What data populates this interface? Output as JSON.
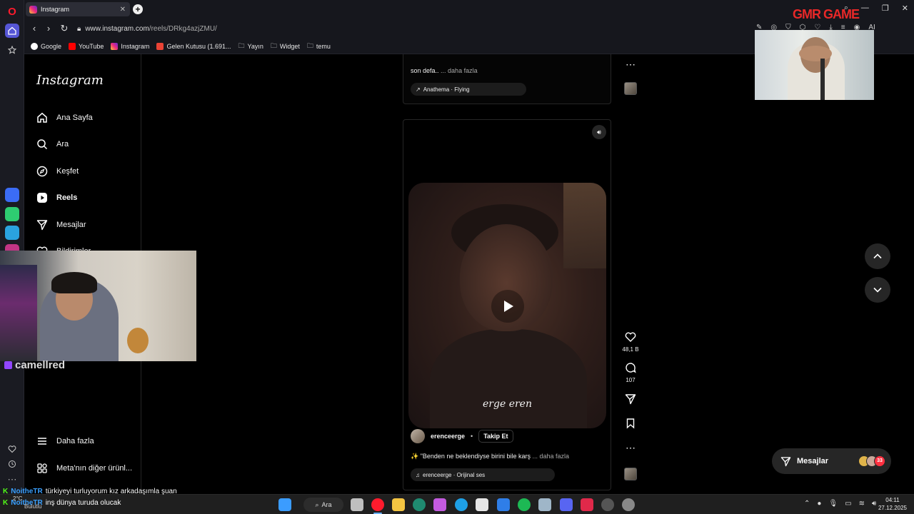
{
  "browser": {
    "tab_title": "Instagram",
    "url_host": "www.instagram.com",
    "url_path": "/reels/DRkg4azjZMU/",
    "brand_overlay": "GMR GAME",
    "bookmarks": [
      {
        "label": "Google",
        "color": "#4285f4"
      },
      {
        "label": "YouTube",
        "color": "#ff0000"
      },
      {
        "label": "Instagram",
        "color": "#e1306c"
      },
      {
        "label": "Gelen Kutusu (1.691...",
        "color": "#ea4335"
      },
      {
        "label": "Yayın",
        "color": ""
      },
      {
        "label": "Widget",
        "color": ""
      },
      {
        "label": "temu",
        "color": ""
      }
    ],
    "ai_label": "AI"
  },
  "sidebar": {
    "logo": "Instagram",
    "items": [
      {
        "label": "Ana Sayfa",
        "icon": "home-icon"
      },
      {
        "label": "Ara",
        "icon": "search-icon"
      },
      {
        "label": "Keşfet",
        "icon": "compass-icon"
      },
      {
        "label": "Reels",
        "icon": "reels-icon"
      },
      {
        "label": "Mesajlar",
        "icon": "send-icon"
      },
      {
        "label": "Bildirimler",
        "icon": "heart-icon"
      }
    ],
    "more": "Daha fazla",
    "meta": "Meta'nın diğer ürünl..."
  },
  "prev_reel": {
    "caption": "son defa..",
    "more": "... daha fazla",
    "audio": "Anathema · Flying"
  },
  "reel": {
    "watermark": "erge eren",
    "username": "erencee rge",
    "username_display": "erenceerge",
    "follow": "Takip Et",
    "caption": "✨ \"Benden ne beklendiyse birini bile karş",
    "more": "... daha fazla",
    "audio": "erenceerge · Orijinal ses",
    "likes": "48,1 B",
    "comments": "107"
  },
  "messages_pill": {
    "label": "Mesajlar",
    "badge": "33"
  },
  "stream": {
    "cam_name": "camellred",
    "chat": [
      {
        "user": "NoitheTR",
        "msg": "türkiyeyi turluyorum kız arkadaşımla şuan"
      },
      {
        "user": "NoitheTR",
        "msg": "inş dünya turuda olucak"
      }
    ],
    "weather_temp": "2°C",
    "weather_desc": "Bulutlu"
  },
  "taskbar": {
    "search": "Ara",
    "time": "04:11",
    "date": "27.12.2025"
  },
  "colors": {
    "accent": "#5656d6",
    "badge": "#ff3040",
    "kick": "#53fc18"
  }
}
